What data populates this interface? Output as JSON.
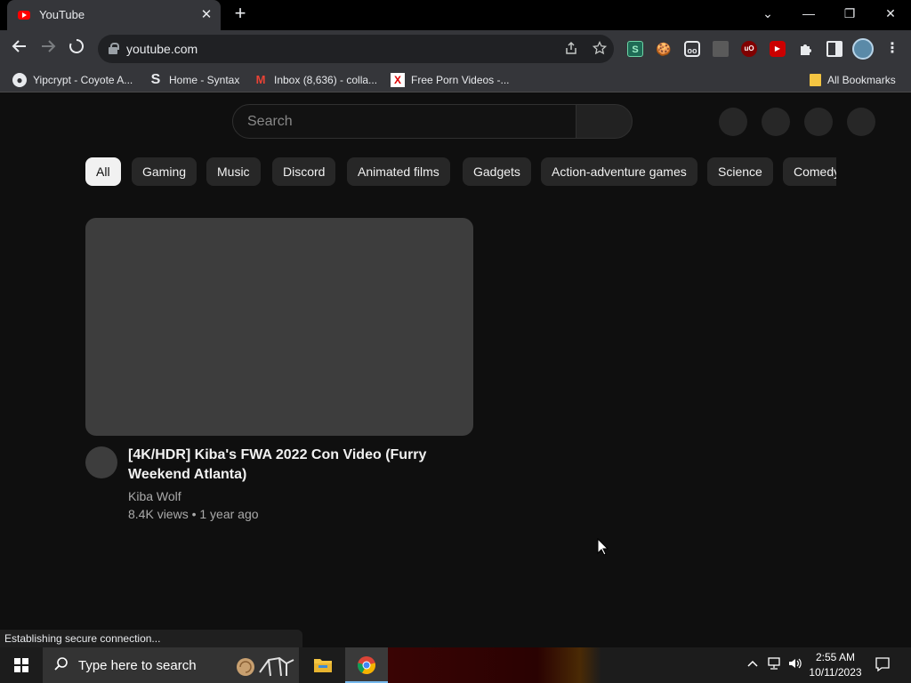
{
  "browser": {
    "tab_title": "YouTube",
    "tab_close": "✕",
    "new_tab": "+",
    "window_controls": {
      "dropdown": "⌄",
      "minimize": "—",
      "restore": "❐",
      "close": "✕"
    },
    "url": "youtube.com",
    "bookmarks": [
      {
        "label": "Yipcrypt - Coyote A...",
        "icon": "globe-icon"
      },
      {
        "label": "Home - Syntax",
        "icon": "syntax-icon"
      },
      {
        "label": "Inbox (8,636) - colla...",
        "icon": "gmail-icon"
      },
      {
        "label": "Free Porn Videos -...",
        "icon": "x-icon"
      }
    ],
    "all_bookmarks": "All Bookmarks",
    "status": "Establishing secure connection..."
  },
  "youtube": {
    "search_placeholder": "Search",
    "chips": [
      "All",
      "Gaming",
      "Music",
      "Discord",
      "Animated films",
      "Gadgets",
      "Action-adventure games",
      "Science",
      "Comedy"
    ],
    "video": {
      "title": "[4K/HDR] Kiba's FWA 2022 Con Video (Furry Weekend Atlanta)",
      "channel": "Kiba Wolf",
      "meta": "8.4K views • 1 year ago"
    }
  },
  "taskbar": {
    "search_placeholder": "Type here to search",
    "time": "2:55 AM",
    "date": "10/11/2023"
  },
  "colors": {
    "page_bg": "#0f0f0f",
    "chip_active_bg": "#f1f1f1",
    "chip_bg": "#272727",
    "youtube_red": "#ff0000"
  }
}
